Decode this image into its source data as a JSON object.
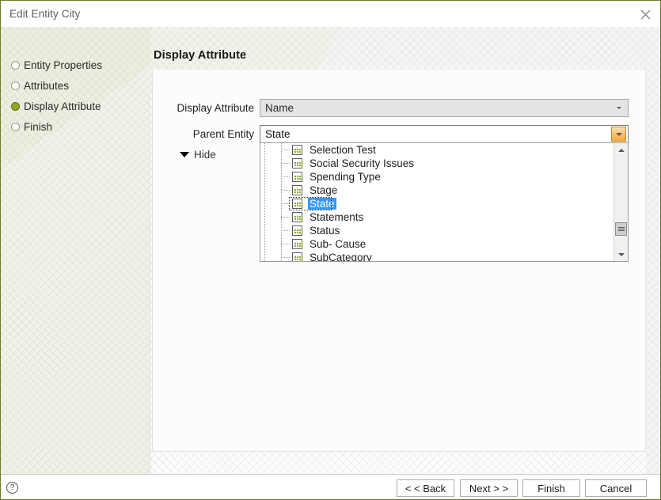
{
  "window": {
    "title": "Edit Entity City",
    "close_icon": "close-icon"
  },
  "sidebar": {
    "items": [
      {
        "label": "Entity Properties",
        "active": false
      },
      {
        "label": "Attributes",
        "active": false
      },
      {
        "label": "Display Attribute",
        "active": true
      },
      {
        "label": "Finish",
        "active": false
      }
    ]
  },
  "main": {
    "page_title": "Display Attribute",
    "fields": {
      "display_attribute": {
        "label": "Display Attribute",
        "value": "Name",
        "disabled": true
      },
      "parent_entity": {
        "label": "Parent Entity",
        "value": "State",
        "disabled": false
      }
    },
    "hide_toggle": {
      "label": "Hide",
      "icon": "triangle-down-icon",
      "expanded": true
    },
    "dropdown": {
      "open": true,
      "selected": "State",
      "items": [
        "Selection Test",
        "Social Security Issues",
        "Spending Type",
        "Stage",
        "State",
        "Statements",
        "Status",
        "Sub- Cause",
        "SubCategory"
      ]
    }
  },
  "footer": {
    "help_label": "?",
    "buttons": {
      "back": "< < Back",
      "next": "Next > >",
      "finish": "Finish",
      "cancel": "Cancel"
    }
  },
  "colors": {
    "accent_green": "#93a821",
    "selection_blue": "#3399ff",
    "dropdown_button_orange": "#f6a937"
  }
}
